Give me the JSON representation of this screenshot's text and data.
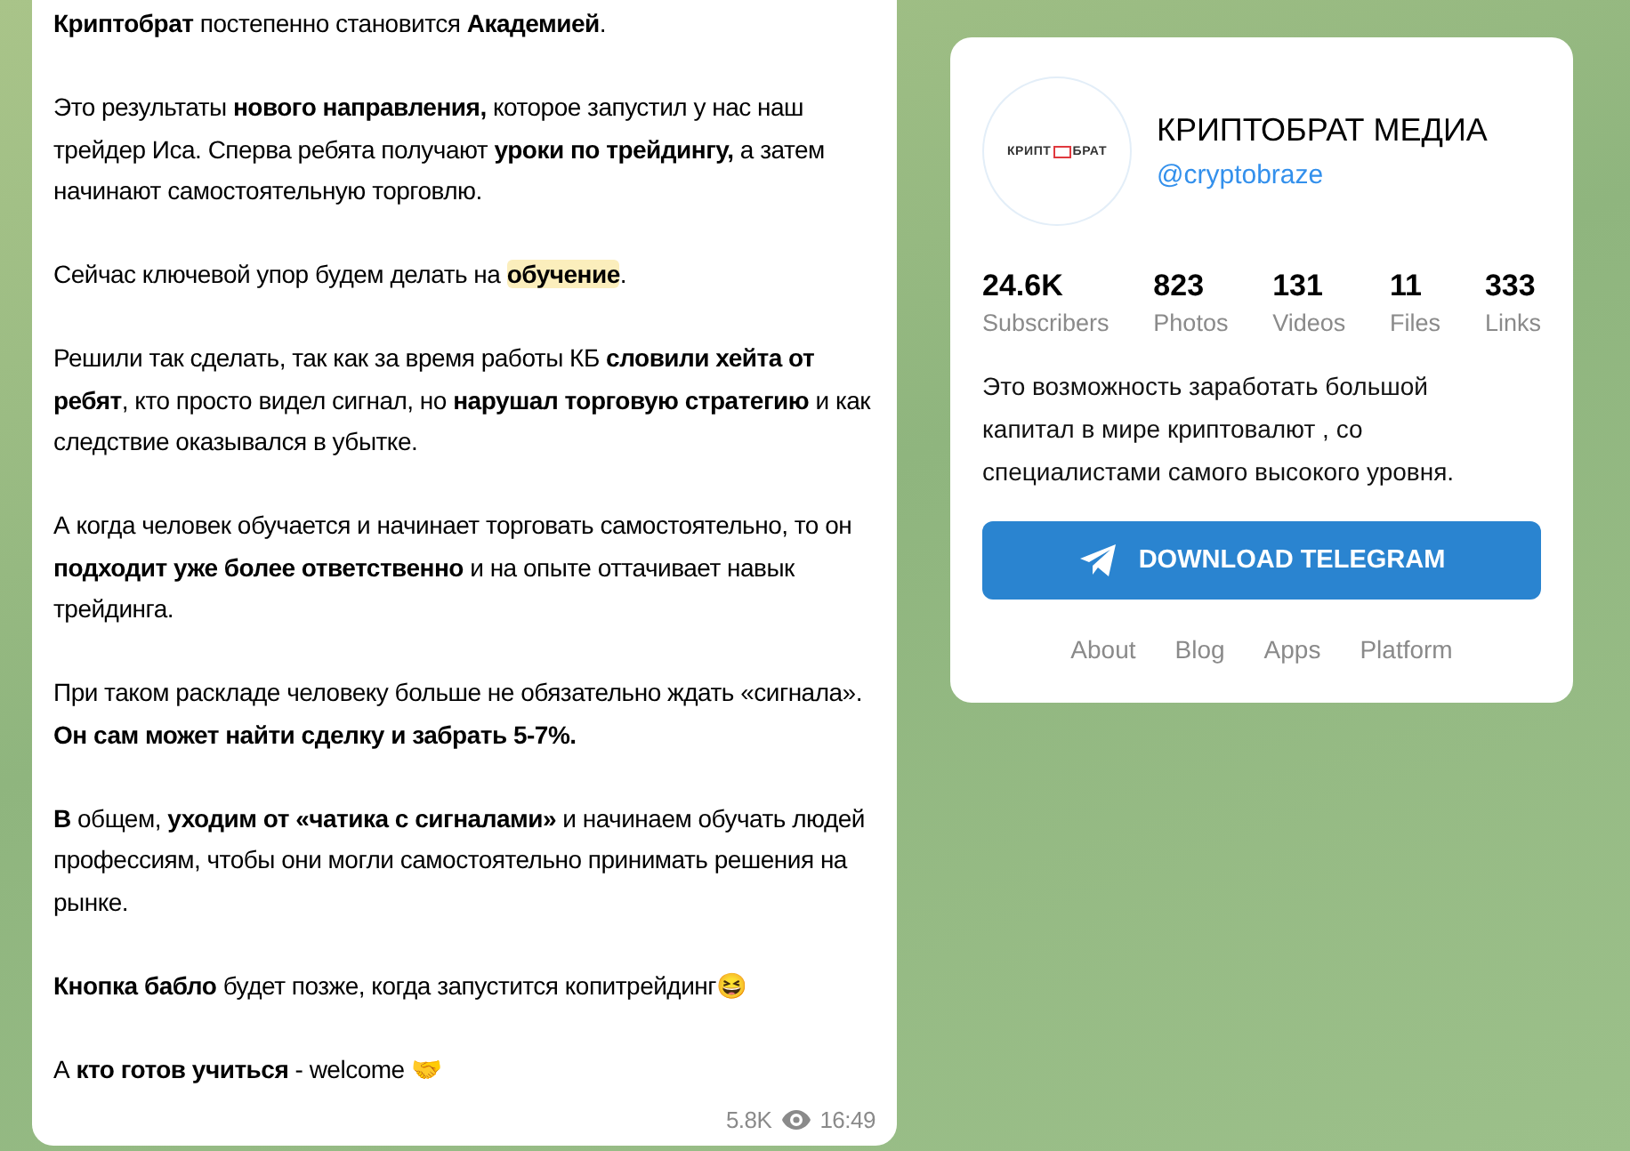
{
  "message": {
    "paragraphs": [
      {
        "text": "**Криптобрат** постепенно становится **Академией**."
      },
      {
        "text": "Это результаты **нового направления,** которое запустил у нас наш трейдер Иса. Сперва ребята получают **уроки по трейдингу,** а затем начинают самостоятельную торговлю."
      },
      {
        "text": "Сейчас ключевой упор будем делать на ",
        "highlight": "обучение",
        "tail": "."
      },
      {
        "text": "Решили так сделать, так как за время работы КБ **словили хейта от ребят**, кто просто видел сигнал, но **нарушал торговую стратегию** и как следствие оказывался в убытке."
      },
      {
        "text": "А когда человек обучается и начинает торговать самостоятельно, то он **подходит уже более ответственно** и на опыте оттачивает навык трейдинга."
      },
      {
        "text": "При таком раскладе человеку больше не обязательно ждать «сигнала». **Он сам может найти сделку и забрать 5-7%.**"
      },
      {
        "text": "**В** общем, **уходим от «чатика с сигналами»** и начинаем обучать людей профессиям, чтобы они могли самостоятельно принимать решения на рынке."
      },
      {
        "text": "**Кнопка бабло** будет позже, когда запустится копитрейдинг😆"
      },
      {
        "text": "А **кто готов учиться** - welcome 🤝"
      }
    ],
    "views": "5.8K",
    "time": "16:49"
  },
  "channel": {
    "logo_parts": [
      "КРИПТ",
      "БРАТ"
    ],
    "name": "КРИПТОБРАТ МЕДИА",
    "username": "@cryptobraze",
    "stats": [
      {
        "value": "24.6K",
        "label": "Subscribers"
      },
      {
        "value": "823",
        "label": "Photos"
      },
      {
        "value": "131",
        "label": "Videos"
      },
      {
        "value": "11",
        "label": "Files"
      },
      {
        "value": "333",
        "label": "Links"
      }
    ],
    "description": "Это возможность заработать большой капитал в мире криптовалют , со специалистами самого высокого уровня.",
    "button": "DOWNLOAD TELEGRAM",
    "links": [
      "About",
      "Blog",
      "Apps",
      "Platform"
    ]
  }
}
